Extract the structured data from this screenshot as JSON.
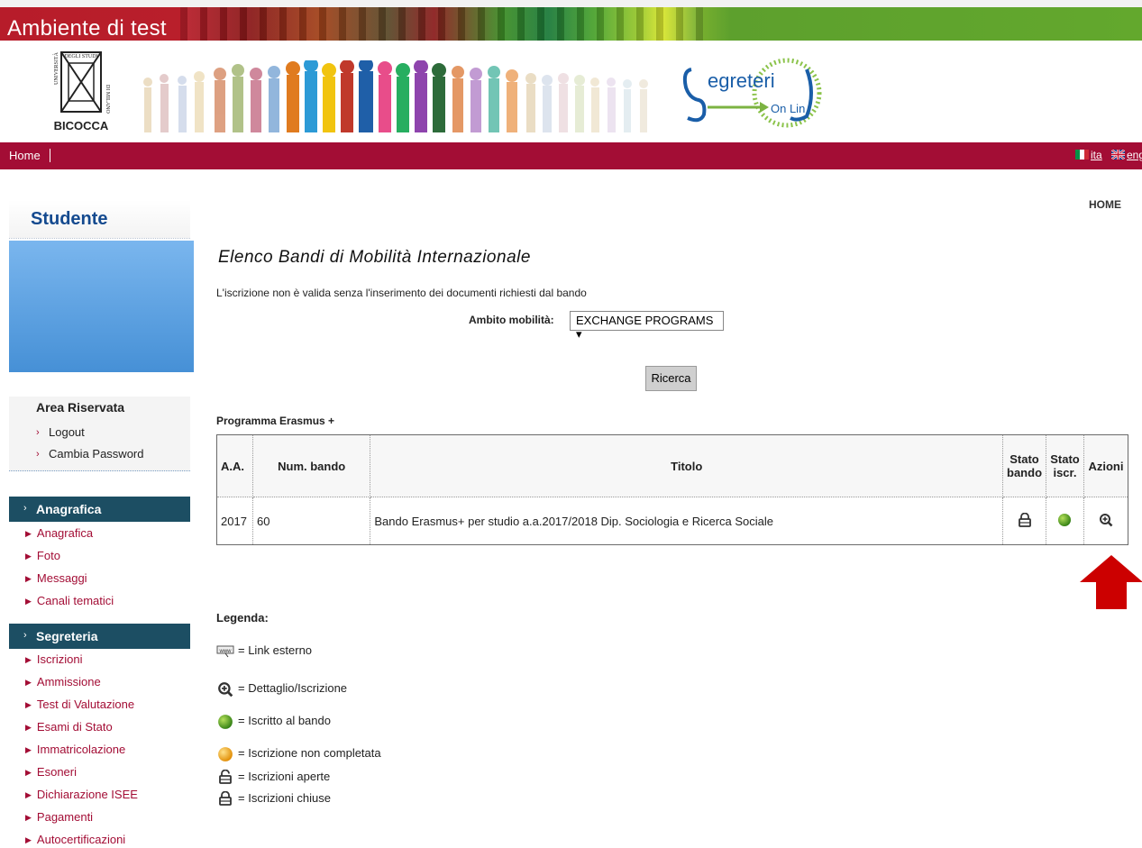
{
  "header": {
    "app_title": "Ambiente di test",
    "university_logo_text": [
      "UNIVERSITÀ",
      "DEGLI STUDI",
      "DI MILANO",
      "BICOCCA"
    ],
    "service_logo_text": "Segreterie On Line"
  },
  "navbar": {
    "home_label": "Home",
    "lang_ita": "ita",
    "lang_eng": "eng"
  },
  "breadcrumb": {
    "home": "HOME"
  },
  "sidebar": {
    "student_title": "Studente",
    "area_riservata": {
      "title": "Area Riservata",
      "links": [
        {
          "label": "Logout"
        },
        {
          "label": "Cambia Password"
        }
      ]
    },
    "sections": [
      {
        "title": "Anagrafica",
        "items": [
          "Anagrafica",
          "Foto",
          "Messaggi",
          "Canali tematici"
        ]
      },
      {
        "title": "Segreteria",
        "items": [
          "Iscrizioni",
          "Ammissione",
          "Test di Valutazione",
          "Esami di Stato",
          "Immatricolazione",
          "Esoneri",
          "Dichiarazione ISEE",
          "Pagamenti",
          "Autocertificazioni"
        ]
      }
    ]
  },
  "main": {
    "title": "Elenco Bandi di Mobilità Internazionale",
    "note": "L'iscrizione non è valida senza l'inserimento dei documenti richiesti dal bando",
    "filter": {
      "label": "Ambito mobilità:",
      "selected": "EXCHANGE PROGRAMS ▾"
    },
    "search_button": "Ricerca",
    "program_label": "Programma Erasmus +",
    "table": {
      "headers": {
        "aa": "A.A.",
        "num": "Num. bando",
        "titolo": "Titolo",
        "stato_bando": "Stato bando",
        "stato_iscr": "Stato iscr.",
        "azioni": "Azioni"
      },
      "rows": [
        {
          "aa": "2017",
          "num": "60",
          "titolo": "Bando Erasmus+ per studio a.a.2017/2018 Dip. Sociologia e Ricerca Sociale",
          "stato_bando_icon": "lock-closed-icon",
          "stato_iscr_icon": "green-dot-icon",
          "azioni_icon": "zoom-detail-icon"
        }
      ]
    },
    "legend": {
      "title": "Legenda:",
      "items": [
        {
          "icon": "www-link-icon",
          "label": "= Link esterno"
        },
        {
          "icon": "zoom-detail-icon",
          "label": "= Dettaglio/Iscrizione"
        },
        {
          "icon": "green-dot-icon",
          "label": "= Iscritto al bando"
        },
        {
          "icon": "orange-dot-icon",
          "label": "= Iscrizione non completata"
        },
        {
          "icon": "lock-open-icon",
          "label": "= Iscrizioni aperte"
        },
        {
          "icon": "lock-closed-icon",
          "label": "= Iscrizioni chiuse"
        }
      ]
    }
  },
  "colors": {
    "navbar": "#a30d35",
    "sidebar_section": "#1c4e63",
    "menu_link": "#a30d35",
    "student_title": "#144a8f",
    "annotation_arrow": "#cc0000"
  }
}
